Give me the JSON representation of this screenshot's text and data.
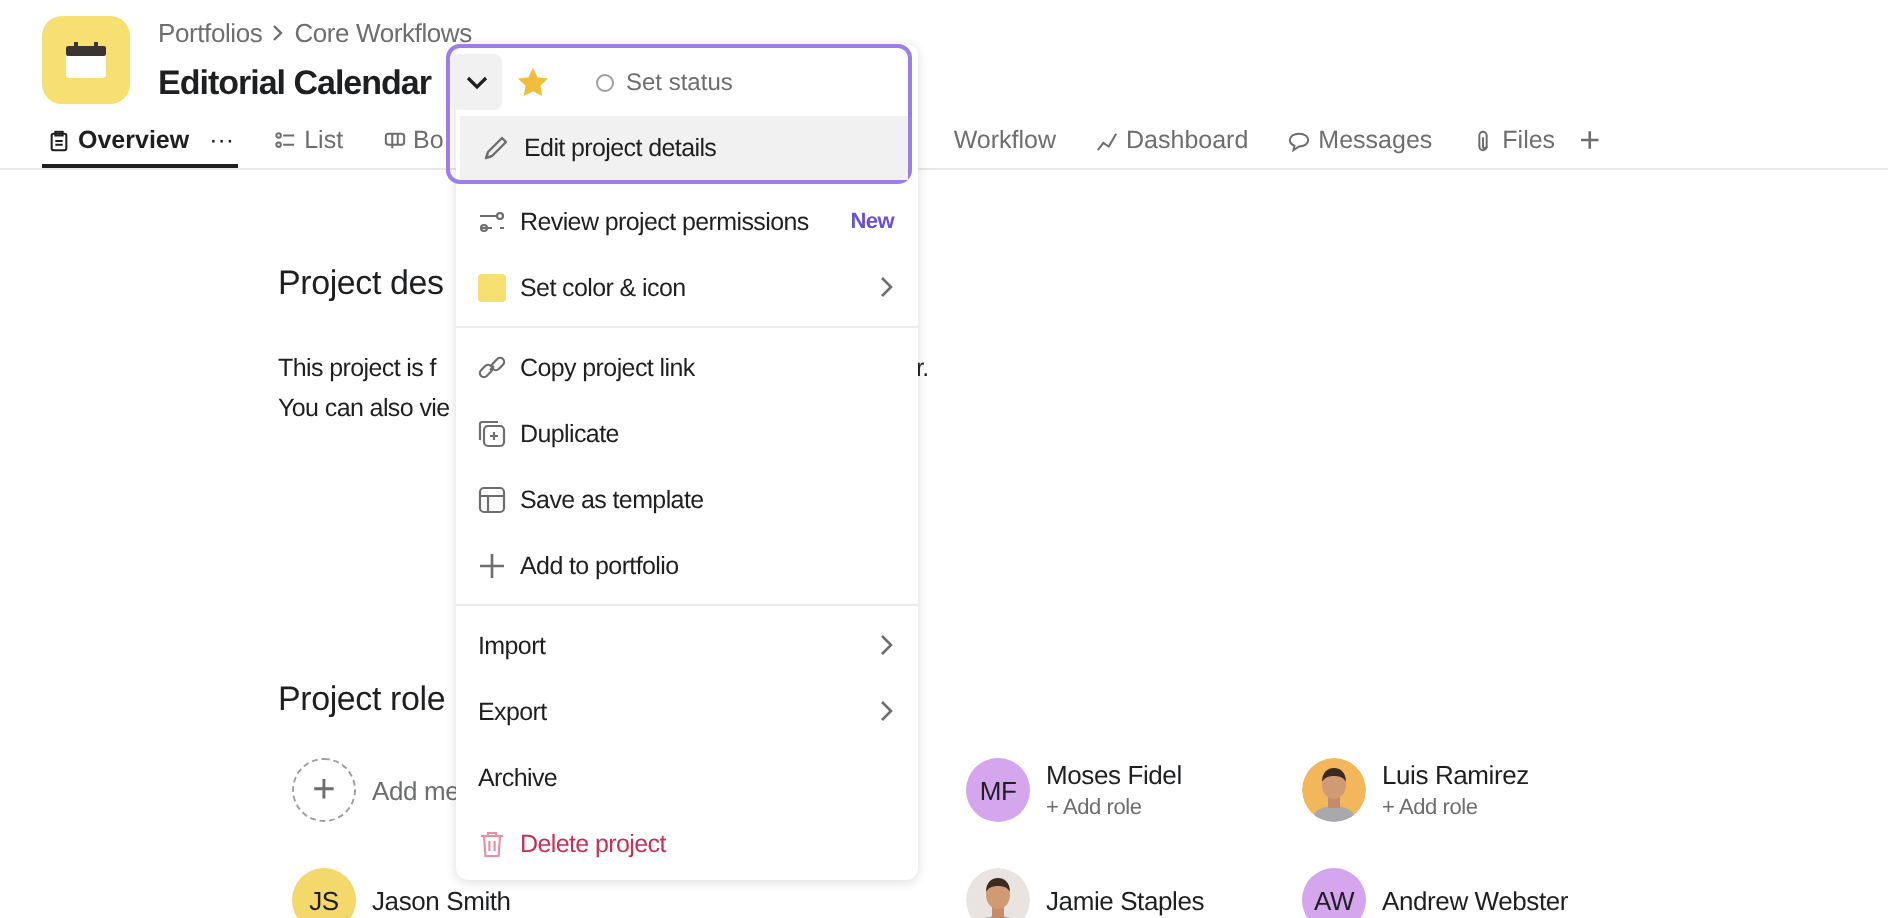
{
  "project": {
    "breadcrumb": [
      {
        "label": "Portfolios"
      },
      {
        "label": "Core Workflows"
      }
    ],
    "title": "Editorial Calendar"
  },
  "tabs": [
    {
      "label": "Overview",
      "selected": true,
      "more": "···"
    },
    {
      "label": "List",
      "selected": false
    },
    {
      "label": "Bo",
      "selected": false
    },
    {
      "label": "Workflow",
      "selected": false
    },
    {
      "label": "Dashboard",
      "selected": false
    },
    {
      "label": "Messages",
      "selected": false
    },
    {
      "label": "Files",
      "selected": false
    }
  ],
  "add_tab": "+",
  "description": {
    "heading": "Project des",
    "lines": [
      {
        "left": "This project is f",
        "right": "r."
      },
      {
        "left": "You can also vie"
      }
    ]
  },
  "roles": {
    "heading": "Project role",
    "members": [
      {
        "kind": "add",
        "name": "Add me",
        "symbol": "+"
      },
      {
        "kind": "initials",
        "initials": "MF",
        "name": "Moses Fidel",
        "sub": "+ Add role",
        "color": "#d5a5ee"
      },
      {
        "name": "Luis Ramirez",
        "sub": "+ Add role",
        "color": "#f2b75b"
      },
      {
        "kind": "initials",
        "initials": "JS",
        "name": "Jason Smith",
        "color": "#f5d86b"
      },
      {
        "name": "Jamie Staples",
        "color": "#e9e4e1"
      },
      {
        "kind": "initials",
        "initials": "AW",
        "name": "Andrew Webster",
        "color": "#d5a5ee"
      }
    ]
  },
  "menu": {
    "status": "Set status",
    "starred": true,
    "items": [
      {
        "kind": "item",
        "label": "Edit project details",
        "selected": true
      },
      {
        "kind": "item",
        "label": "Review project permissions",
        "badge": "New",
        "selected": false
      },
      {
        "kind": "item",
        "label": "Set color & icon",
        "submenu": true,
        "selected": false
      },
      {
        "kind": "divider"
      },
      {
        "kind": "item",
        "label": "Copy project link",
        "selected": false
      },
      {
        "kind": "item",
        "label": "Duplicate",
        "selected": false
      },
      {
        "kind": "item",
        "label": "Save as template",
        "selected": false
      },
      {
        "kind": "item",
        "label": "Add to portfolio",
        "selected": false
      },
      {
        "kind": "divider"
      },
      {
        "kind": "item",
        "label": "Import",
        "submenu": true,
        "selected": false
      },
      {
        "kind": "item",
        "label": "Export",
        "submenu": true,
        "selected": false
      },
      {
        "kind": "item",
        "label": "Archive",
        "selected": false
      },
      {
        "kind": "danger",
        "label": "Delete project",
        "selected": false
      }
    ]
  }
}
